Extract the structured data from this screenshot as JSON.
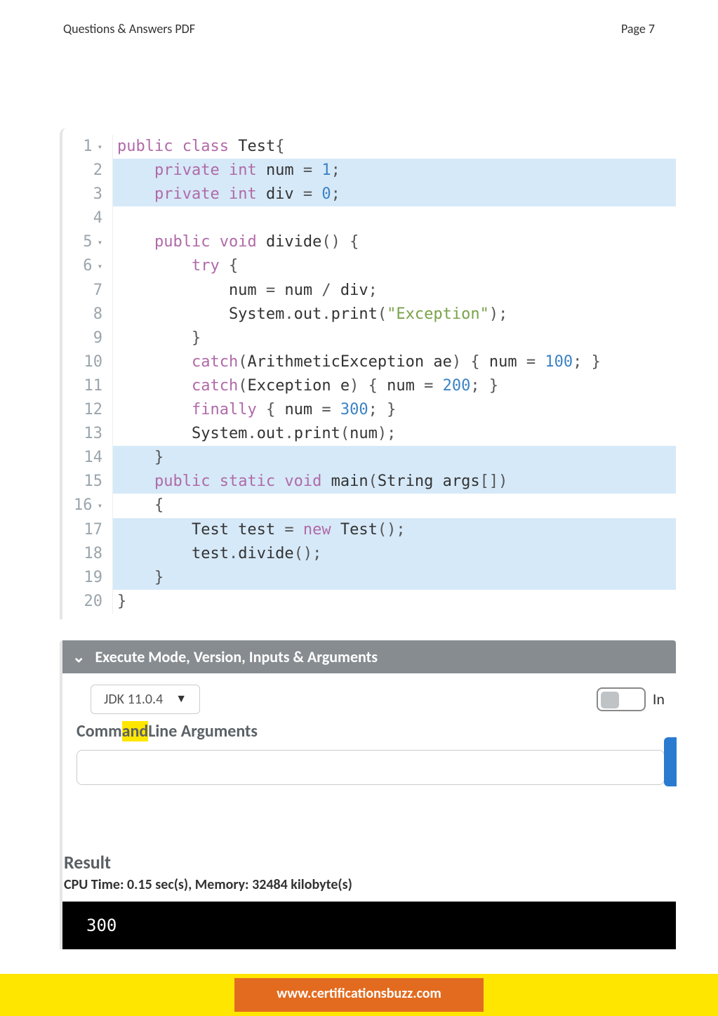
{
  "header": {
    "left": "Questions & Answers PDF",
    "right": "Page 7"
  },
  "code": {
    "lines": [
      {
        "n": "1",
        "fold": true,
        "hl": false,
        "tokens": [
          [
            "kw",
            "public "
          ],
          [
            "kw",
            "class "
          ],
          [
            "ident",
            "Test"
          ],
          [
            "punc",
            "{"
          ]
        ]
      },
      {
        "n": "2",
        "fold": false,
        "hl": true,
        "tokens": [
          [
            "ident",
            "    "
          ],
          [
            "kw",
            "private "
          ],
          [
            "typ",
            "int "
          ],
          [
            "ident",
            "num "
          ],
          [
            "punc",
            "= "
          ],
          [
            "num",
            "1"
          ],
          [
            "punc",
            ";"
          ]
        ]
      },
      {
        "n": "3",
        "fold": false,
        "hl": true,
        "tokens": [
          [
            "ident",
            "    "
          ],
          [
            "kw",
            "private "
          ],
          [
            "typ",
            "int "
          ],
          [
            "ident",
            "div "
          ],
          [
            "punc",
            "= "
          ],
          [
            "num",
            "0"
          ],
          [
            "punc",
            ";"
          ]
        ]
      },
      {
        "n": "4",
        "fold": false,
        "hl": false,
        "tokens": []
      },
      {
        "n": "5",
        "fold": true,
        "hl": false,
        "tokens": [
          [
            "ident",
            "    "
          ],
          [
            "kw",
            "public "
          ],
          [
            "typ",
            "void "
          ],
          [
            "ident",
            "divide"
          ],
          [
            "punc",
            "() {"
          ]
        ]
      },
      {
        "n": "6",
        "fold": true,
        "hl": false,
        "tokens": [
          [
            "ident",
            "        "
          ],
          [
            "kw",
            "try "
          ],
          [
            "punc",
            "{"
          ]
        ]
      },
      {
        "n": "7",
        "fold": false,
        "hl": false,
        "tokens": [
          [
            "ident",
            "            num "
          ],
          [
            "punc",
            "= "
          ],
          [
            "ident",
            "num "
          ],
          [
            "punc",
            "/ "
          ],
          [
            "ident",
            "div"
          ],
          [
            "punc",
            ";"
          ]
        ]
      },
      {
        "n": "8",
        "fold": false,
        "hl": false,
        "tokens": [
          [
            "ident",
            "            System"
          ],
          [
            "punc",
            "."
          ],
          [
            "ident",
            "out"
          ],
          [
            "punc",
            "."
          ],
          [
            "ident",
            "print"
          ],
          [
            "punc",
            "("
          ],
          [
            "str",
            "\"Exception\""
          ],
          [
            "punc",
            ");"
          ]
        ]
      },
      {
        "n": "9",
        "fold": false,
        "hl": false,
        "tokens": [
          [
            "ident",
            "        "
          ],
          [
            "punc",
            "}"
          ]
        ]
      },
      {
        "n": "10",
        "fold": false,
        "hl": false,
        "tokens": [
          [
            "ident",
            "        "
          ],
          [
            "kw",
            "catch"
          ],
          [
            "punc",
            "("
          ],
          [
            "ident",
            "ArithmeticException ae"
          ],
          [
            "punc",
            ") { "
          ],
          [
            "ident",
            "num "
          ],
          [
            "punc",
            "= "
          ],
          [
            "num",
            "100"
          ],
          [
            "punc",
            "; }"
          ]
        ]
      },
      {
        "n": "11",
        "fold": false,
        "hl": false,
        "tokens": [
          [
            "ident",
            "        "
          ],
          [
            "kw",
            "catch"
          ],
          [
            "punc",
            "("
          ],
          [
            "ident",
            "Exception e"
          ],
          [
            "punc",
            ") { "
          ],
          [
            "ident",
            "num "
          ],
          [
            "punc",
            "= "
          ],
          [
            "num",
            "200"
          ],
          [
            "punc",
            "; }"
          ]
        ]
      },
      {
        "n": "12",
        "fold": false,
        "hl": false,
        "tokens": [
          [
            "ident",
            "        "
          ],
          [
            "kw",
            "finally "
          ],
          [
            "punc",
            "{ "
          ],
          [
            "ident",
            "num "
          ],
          [
            "punc",
            "= "
          ],
          [
            "num",
            "300"
          ],
          [
            "punc",
            "; }"
          ]
        ]
      },
      {
        "n": "13",
        "fold": false,
        "hl": false,
        "tokens": [
          [
            "ident",
            "        System"
          ],
          [
            "punc",
            "."
          ],
          [
            "ident",
            "out"
          ],
          [
            "punc",
            "."
          ],
          [
            "ident",
            "print"
          ],
          [
            "punc",
            "("
          ],
          [
            "ident",
            "num"
          ],
          [
            "punc",
            ");"
          ]
        ]
      },
      {
        "n": "14",
        "fold": false,
        "hl": true,
        "tokens": [
          [
            "ident",
            "    "
          ],
          [
            "punc",
            "}"
          ]
        ]
      },
      {
        "n": "15",
        "fold": false,
        "hl": true,
        "tokens": [
          [
            "ident",
            "    "
          ],
          [
            "kw",
            "public "
          ],
          [
            "kw",
            "static "
          ],
          [
            "typ",
            "void "
          ],
          [
            "ident",
            "main"
          ],
          [
            "punc",
            "("
          ],
          [
            "ident",
            "String args"
          ],
          [
            "punc",
            "[])"
          ]
        ]
      },
      {
        "n": "16",
        "fold": true,
        "hl": false,
        "tokens": [
          [
            "ident",
            "    "
          ],
          [
            "punc",
            "{"
          ]
        ]
      },
      {
        "n": "17",
        "fold": false,
        "hl": true,
        "tokens": [
          [
            "ident",
            "        Test test "
          ],
          [
            "punc",
            "= "
          ],
          [
            "kw",
            "new "
          ],
          [
            "ident",
            "Test"
          ],
          [
            "punc",
            "();"
          ]
        ]
      },
      {
        "n": "18",
        "fold": false,
        "hl": true,
        "tokens": [
          [
            "ident",
            "        test"
          ],
          [
            "punc",
            "."
          ],
          [
            "ident",
            "divide"
          ],
          [
            "punc",
            "();"
          ]
        ]
      },
      {
        "n": "19",
        "fold": false,
        "hl": true,
        "tokens": [
          [
            "ident",
            "    "
          ],
          [
            "punc",
            "}"
          ]
        ]
      },
      {
        "n": "20",
        "fold": false,
        "hl": false,
        "tokens": [
          [
            "punc",
            "}"
          ]
        ]
      }
    ]
  },
  "section": {
    "title": "Execute Mode, Version, Inputs & Arguments"
  },
  "jdk": {
    "selected": "JDK 11.0.4"
  },
  "toggle": {
    "label": "In"
  },
  "cmd": {
    "label_pre": "Comm",
    "label_and": "and",
    "label_post": "Line Arguments",
    "value": ""
  },
  "result": {
    "title": "Result",
    "meta": "CPU Time: 0.15 sec(s), Memory: 32484 kilobyte(s)",
    "output": "300"
  },
  "footer": {
    "url": "www.certificationsbuzz.com"
  }
}
